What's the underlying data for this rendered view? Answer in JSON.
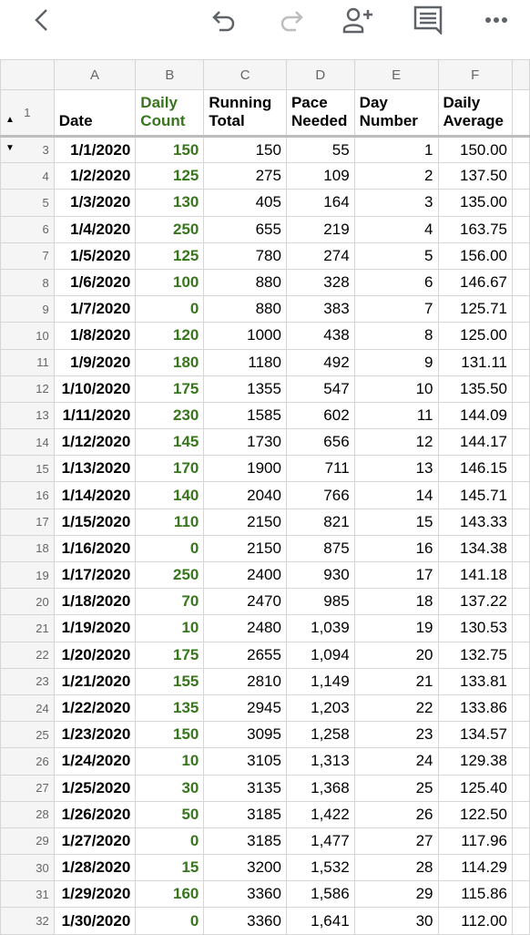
{
  "toolbar": {
    "icons": [
      "back-icon",
      "undo-icon",
      "redo-icon",
      "share-add-person-icon",
      "comment-icon",
      "more-icon"
    ]
  },
  "colors": {
    "accent_green": "#38761d"
  },
  "columns": [
    "A",
    "B",
    "C",
    "D",
    "E",
    "F"
  ],
  "header_row": {
    "row_number": "1",
    "cells": [
      [
        "Date"
      ],
      [
        "Daily",
        "Count"
      ],
      [
        "Running",
        "Total"
      ],
      [
        "Pace",
        "Needed"
      ],
      [
        "Day",
        "Number"
      ],
      [
        "Daily",
        "Average"
      ]
    ]
  },
  "rows": [
    [
      "3",
      "1/1/2020",
      "150",
      "150",
      "55",
      "1",
      "150.00"
    ],
    [
      "4",
      "1/2/2020",
      "125",
      "275",
      "109",
      "2",
      "137.50"
    ],
    [
      "5",
      "1/3/2020",
      "130",
      "405",
      "164",
      "3",
      "135.00"
    ],
    [
      "6",
      "1/4/2020",
      "250",
      "655",
      "219",
      "4",
      "163.75"
    ],
    [
      "7",
      "1/5/2020",
      "125",
      "780",
      "274",
      "5",
      "156.00"
    ],
    [
      "8",
      "1/6/2020",
      "100",
      "880",
      "328",
      "6",
      "146.67"
    ],
    [
      "9",
      "1/7/2020",
      "0",
      "880",
      "383",
      "7",
      "125.71"
    ],
    [
      "10",
      "1/8/2020",
      "120",
      "1000",
      "438",
      "8",
      "125.00"
    ],
    [
      "11",
      "1/9/2020",
      "180",
      "1180",
      "492",
      "9",
      "131.11"
    ],
    [
      "12",
      "1/10/2020",
      "175",
      "1355",
      "547",
      "10",
      "135.50"
    ],
    [
      "13",
      "1/11/2020",
      "230",
      "1585",
      "602",
      "11",
      "144.09"
    ],
    [
      "14",
      "1/12/2020",
      "145",
      "1730",
      "656",
      "12",
      "144.17"
    ],
    [
      "15",
      "1/13/2020",
      "170",
      "1900",
      "711",
      "13",
      "146.15"
    ],
    [
      "16",
      "1/14/2020",
      "140",
      "2040",
      "766",
      "14",
      "145.71"
    ],
    [
      "17",
      "1/15/2020",
      "110",
      "2150",
      "821",
      "15",
      "143.33"
    ],
    [
      "18",
      "1/16/2020",
      "0",
      "2150",
      "875",
      "16",
      "134.38"
    ],
    [
      "19",
      "1/17/2020",
      "250",
      "2400",
      "930",
      "17",
      "141.18"
    ],
    [
      "20",
      "1/18/2020",
      "70",
      "2470",
      "985",
      "18",
      "137.22"
    ],
    [
      "21",
      "1/19/2020",
      "10",
      "2480",
      "1,039",
      "19",
      "130.53"
    ],
    [
      "22",
      "1/20/2020",
      "175",
      "2655",
      "1,094",
      "20",
      "132.75"
    ],
    [
      "23",
      "1/21/2020",
      "155",
      "2810",
      "1,149",
      "21",
      "133.81"
    ],
    [
      "24",
      "1/22/2020",
      "135",
      "2945",
      "1,203",
      "22",
      "133.86"
    ],
    [
      "25",
      "1/23/2020",
      "150",
      "3095",
      "1,258",
      "23",
      "134.57"
    ],
    [
      "26",
      "1/24/2020",
      "10",
      "3105",
      "1,313",
      "24",
      "129.38"
    ],
    [
      "27",
      "1/25/2020",
      "30",
      "3135",
      "1,368",
      "25",
      "125.40"
    ],
    [
      "28",
      "1/26/2020",
      "50",
      "3185",
      "1,422",
      "26",
      "122.50"
    ],
    [
      "29",
      "1/27/2020",
      "0",
      "3185",
      "1,477",
      "27",
      "117.96"
    ],
    [
      "30",
      "1/28/2020",
      "15",
      "3200",
      "1,532",
      "28",
      "114.29"
    ],
    [
      "31",
      "1/29/2020",
      "160",
      "3360",
      "1,586",
      "29",
      "115.86"
    ],
    [
      "32",
      "1/30/2020",
      "0",
      "3360",
      "1,641",
      "30",
      "112.00"
    ]
  ]
}
